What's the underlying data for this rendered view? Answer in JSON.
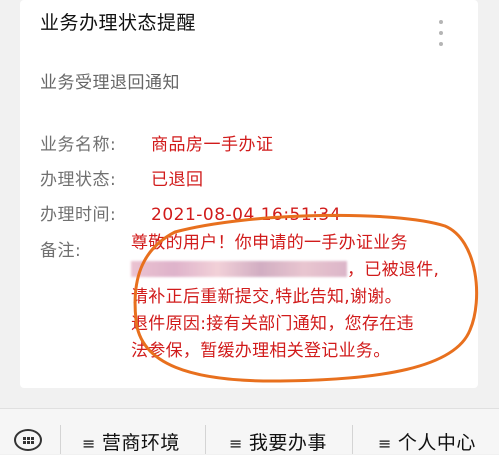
{
  "card": {
    "title": "业务办理状态提醒",
    "subtitle": "业务受理退回通知",
    "more_icon": "more-vertical-icon"
  },
  "fields": {
    "business_name_label": "业务名称:",
    "business_name_value": "商品房一手办证",
    "status_label": "办理状态:",
    "status_value": "已退回",
    "time_label": "办理时间:",
    "time_value": "2021-08-04 16:51:34",
    "note_label": "备注:"
  },
  "note": {
    "line1": "尊敬的用户！你申请的一手办证业务",
    "line2_suffix": "，已被退件,",
    "line3": "请补正后重新提交,特此告知,谢谢。",
    "line4": "退件原因:接有关部门通知，您存在违",
    "line5": "法参保，暂缓办理相关登记业务。"
  },
  "bottom_bar": {
    "keyboard_icon": "keyboard-icon",
    "menu_icon": "≡",
    "menu1": "营商环境",
    "menu2": "我要办事",
    "menu3": "个人中心"
  },
  "colors": {
    "accent_red": "#d11b1b",
    "annotation_orange": "#e8701e"
  }
}
